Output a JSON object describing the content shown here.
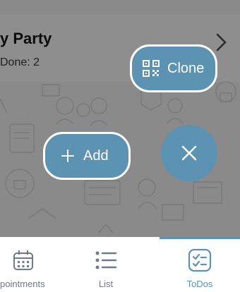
{
  "card": {
    "title": "y Party",
    "subtitle": "Done: 2"
  },
  "actions": {
    "clone_label": "Clone",
    "add_label": "Add"
  },
  "tabs": [
    {
      "label": "pointments",
      "icon": "calendar-icon",
      "selected": false
    },
    {
      "label": "List",
      "icon": "list-icon",
      "selected": false
    },
    {
      "label": "ToDos",
      "icon": "checklist-icon",
      "selected": true
    }
  ],
  "colors": {
    "accent": "#5c93b2",
    "overlay": "#8a8a8a",
    "tab_inactive": "#6e7b88"
  }
}
